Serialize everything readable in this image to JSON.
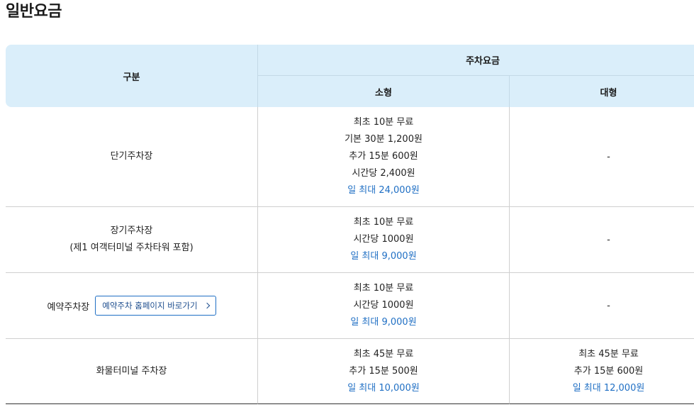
{
  "page_title": "일반요금",
  "table": {
    "header": {
      "category": "구분",
      "parking_fee": "주차요금",
      "small": "소형",
      "large": "대형"
    },
    "rows": [
      {
        "name": "단기주차장",
        "small": [
          "최초 10분 무료",
          "기본 30분 1,200원",
          "추가 15분 600원",
          "시간당 2,400원"
        ],
        "small_max": "일 최대 24,000원",
        "large": "-"
      },
      {
        "name": "장기주차장",
        "name_sub": "(제1 여객터미널 주차타워 포함)",
        "small": [
          "최초 10분 무료",
          "시간당 1000원"
        ],
        "small_max": "일 최대 9,000원",
        "large": "-"
      },
      {
        "name": "예약주차장",
        "link_label": "예약주차 홈페이지 바로가기",
        "link_icon": "chevron-right-icon",
        "small": [
          "최초 10분 무료",
          "시간당 1000원"
        ],
        "small_max": "일 최대 9,000원",
        "large": "-"
      },
      {
        "name": "화물터미널 주차장",
        "small": [
          "최초 45분 무료",
          "추가 15분 500원"
        ],
        "small_max": "일 최대 10,000원",
        "large_lines": [
          "최초 45분 무료",
          "추가 15분 600원"
        ],
        "large_max": "일 최대 12,000원"
      }
    ]
  },
  "colors": {
    "header_bg": "#daeefa",
    "accent_blue": "#1f6fc4"
  }
}
